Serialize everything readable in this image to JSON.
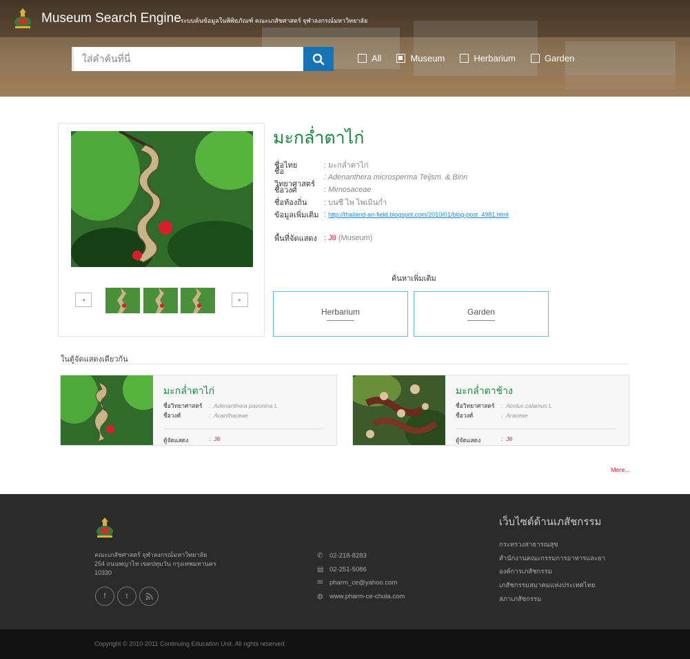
{
  "header": {
    "title": "Museum Search Engine",
    "subtitle": "- ระบบค้นข้อมูลในพิพิธภัณฑ์ คณะเภสัชศาสตร์ จุฬาลงกรณ์มหาวิทยาลัย",
    "search_placeholder": "ใส่คำค้นที่นี่",
    "filters": [
      {
        "label": "All",
        "checked": false
      },
      {
        "label": "Museum",
        "checked": true
      },
      {
        "label": "Herbarium",
        "checked": false
      },
      {
        "label": "Garden",
        "checked": false
      }
    ]
  },
  "detail": {
    "title": "มะกล่ำตาไก่",
    "fields": [
      {
        "label": "ชื่อไทย",
        "value": ": มะกล่ำตาไก่"
      },
      {
        "label": "ชื่อวิทยาศาสตร์",
        "value": ": Adenanthera microsperma Teijsm. & Binn"
      },
      {
        "label": "ชื่อวงศ์",
        "value": ": Mimosaceae"
      },
      {
        "label": "ชื่อท้องถิ่น",
        "value": ": บนซี ไพ ไพเมินก่ำ"
      },
      {
        "label": "ข้อมูลเพิ่มเติม",
        "value": "http://thailand-an-field.blogspot.com/2010/01/blog-post_4981.html"
      }
    ],
    "location_label": "พื้นที่จัดแสดง",
    "location_code": "J8",
    "location_type": "(Museum)",
    "more_search_title": "ค้นหาเพิ่มเติม",
    "more_buttons": [
      "Herbarium",
      "Garden"
    ]
  },
  "same_cabinet": {
    "title": "ในตู้จัดแสดงเดียวกัน",
    "items": [
      {
        "name": "มะกล่ำตาไก่",
        "sci_label": "ชื่อวิทยาศาสตร์",
        "sci": "Adenanthera pavonina L",
        "family_label": "ชื่อวงศ์",
        "family": "Acanthaceae",
        "loc_label": "ตู้จัดแสดง",
        "loc": "J8"
      },
      {
        "name": "มะกล่ำตาช้าง",
        "sci_label": "ชื่อวิทยาศาสตร์",
        "sci": "Acolus calamus L",
        "family_label": "ชื่อวงศ์",
        "family": "Araceae",
        "loc_label": "ตู้จัดแสดง",
        "loc": "J8"
      }
    ],
    "more": "More..."
  },
  "footer": {
    "address": [
      "คณะเภสัชศาสตร์ จุฬาลงกรณ์มหาวิทยาลัย",
      "254 ถนนพญาไท เขตปทุมวัน กรุงเทพมหานคร",
      "10330"
    ],
    "social": [
      "f",
      "t",
      "rss"
    ],
    "contacts": [
      {
        "icon": "phone-icon",
        "text": "02-218-8283"
      },
      {
        "icon": "fax-icon",
        "text": "02-251-5086"
      },
      {
        "icon": "mail-icon",
        "text": "pharm_ce@yahoo.com"
      },
      {
        "icon": "globe-icon",
        "text": "www.pharm-ce-chula.com"
      }
    ],
    "links_title": "เว็บไซต์ด้านเภสัชกรรม",
    "links": [
      "กระทรวงสาธารณสุข",
      "สำนักงานคณะกรรมการอาหารและยา",
      "องค์การเภสัชกรรม",
      "เภสัชกรรมสมาคมแห่งประเทศไทย",
      "สภาเภสัชกรรม"
    ],
    "copyright": "Copyright © 2010-2011 Continuing Education Unit. All rights reserved."
  },
  "colors": {
    "accent_green": "#178a3a",
    "accent_blue": "#1673b6",
    "accent_red": "#e0213a"
  }
}
